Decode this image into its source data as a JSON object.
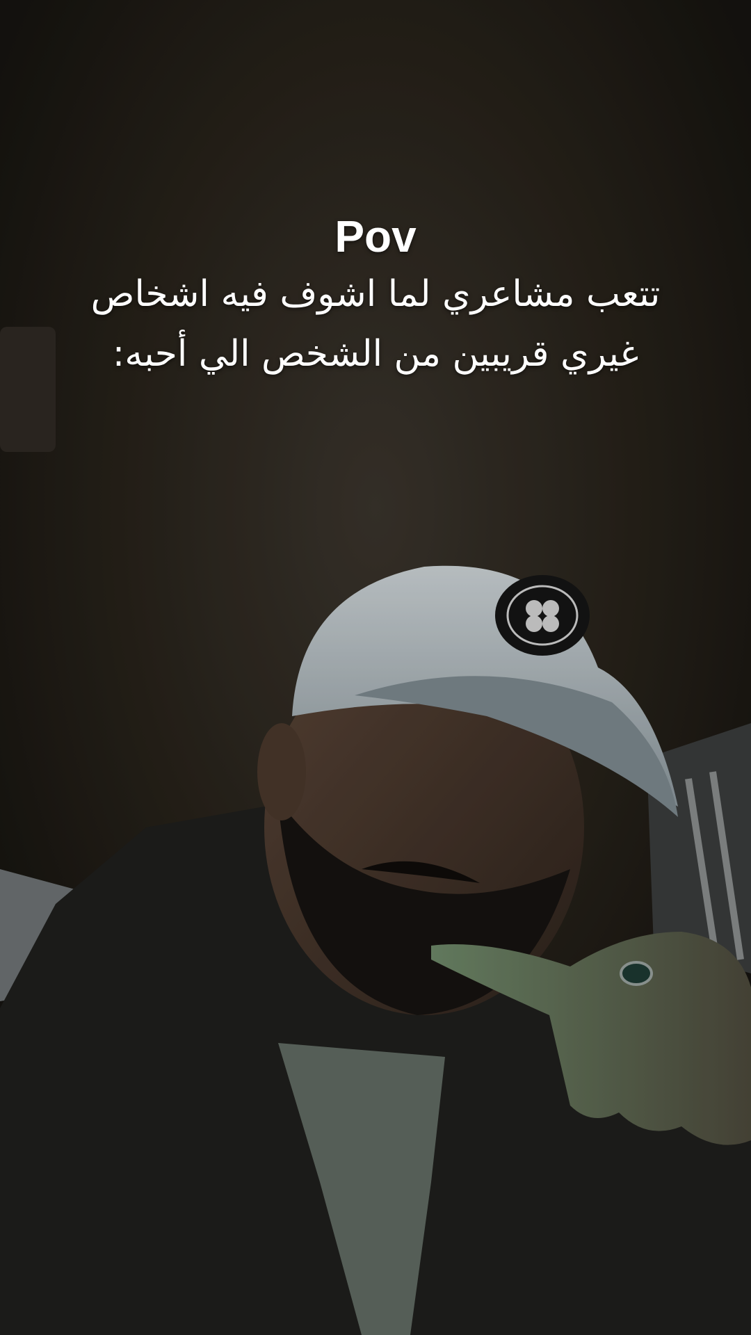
{
  "caption": {
    "title": "Pov",
    "line1": "تتعب مشاعري لما اشوف فيه اشخاص",
    "line2": "غيري قريبين من الشخص الي أحبه:"
  },
  "colors": {
    "caption_text": "#ffffff",
    "background_dark": "#1c1915",
    "cap": "#b7c1c6"
  }
}
